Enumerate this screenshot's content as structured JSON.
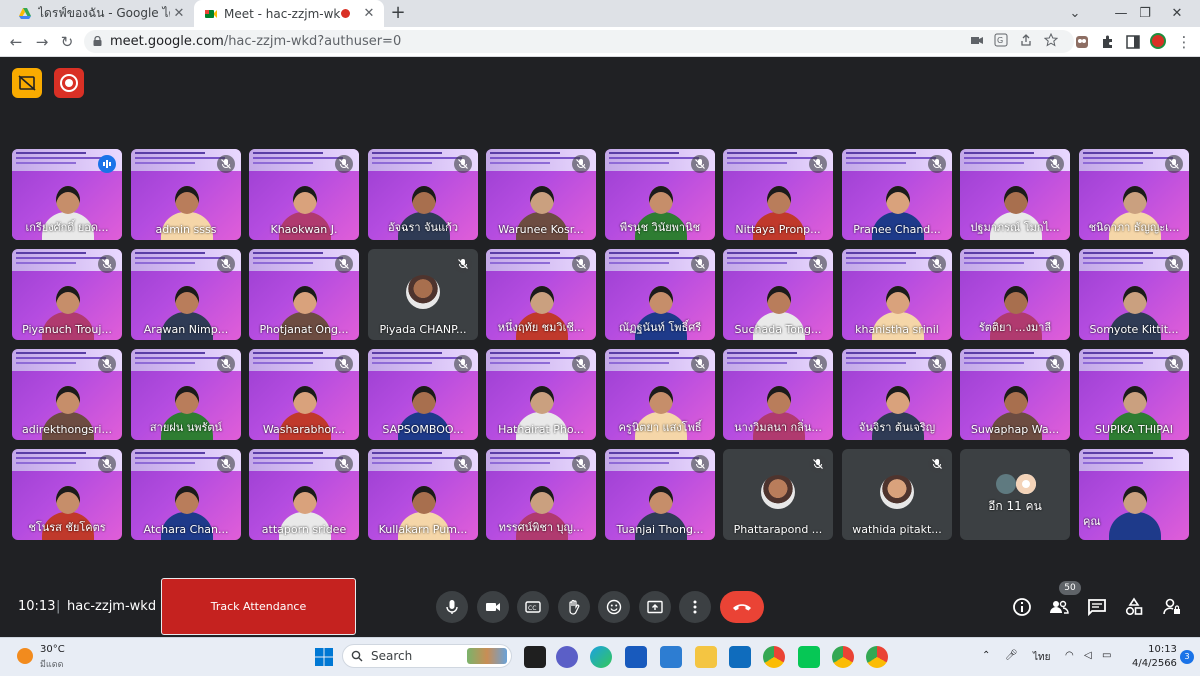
{
  "browser": {
    "tabs": [
      {
        "label": "ไดรฟ์ของฉัน - Google ไดรฟ์",
        "active": false
      },
      {
        "label": "Meet - hac-zzjm-wkd",
        "active": true
      }
    ],
    "url_host": "meet.google.com",
    "url_path": "/hac-zzjm-wkd?authuser=0"
  },
  "meet": {
    "time": "10:13",
    "separator": "|",
    "meeting_code": "hac-zzjm-wkd",
    "attendance_button": "Track Attendance",
    "participant_count": "50",
    "tiles": [
      {
        "name": "เกรียงศักดิ์ ยอด...",
        "type": "video",
        "speaking": true
      },
      {
        "name": "admin ssss",
        "type": "video"
      },
      {
        "name": "Khaokwan J.",
        "type": "video"
      },
      {
        "name": "อัจฉรา จันแก้ว",
        "type": "video"
      },
      {
        "name": "Warunee Kosr...",
        "type": "video"
      },
      {
        "name": "พีรนุช วินัยพานิช",
        "type": "video"
      },
      {
        "name": "Nittaya Pronp...",
        "type": "video"
      },
      {
        "name": "Pranee Chand...",
        "type": "video"
      },
      {
        "name": "ปฐมาภรณ์ โมกไ...",
        "type": "video"
      },
      {
        "name": "ชนิดาภา ธัญญะเ...",
        "type": "video"
      },
      {
        "name": "Piyanuch Trouj...",
        "type": "video"
      },
      {
        "name": "Arawan Nimp...",
        "type": "video"
      },
      {
        "name": "Photjanat Ong...",
        "type": "video"
      },
      {
        "name": "Piyada CHANP...",
        "type": "avatar"
      },
      {
        "name": "หนึ่งฤทัย ชมวิเชี...",
        "type": "video"
      },
      {
        "name": "ณัฏฐนันท์ โพธิ์ศรี",
        "type": "video"
      },
      {
        "name": "Suchada Tong...",
        "type": "video"
      },
      {
        "name": "khanistha srinil",
        "type": "video"
      },
      {
        "name": "รัตติยา ...งมาลี",
        "type": "video"
      },
      {
        "name": "Somyote Kittit...",
        "type": "video"
      },
      {
        "name": "adirekthongsri...",
        "type": "video"
      },
      {
        "name": "สายฝน นพรัตน์",
        "type": "video"
      },
      {
        "name": "Washarabhor...",
        "type": "video"
      },
      {
        "name": "SAPSOMBOO...",
        "type": "video"
      },
      {
        "name": "Hathairat Pho...",
        "type": "video"
      },
      {
        "name": "ครูนิตยา แสงโพธิ์",
        "type": "video"
      },
      {
        "name": "นางวิมลนา กลิ่น...",
        "type": "video"
      },
      {
        "name": "จันจิรา ต้นเจริญ",
        "type": "video"
      },
      {
        "name": "Suwaphap Wa...",
        "type": "video"
      },
      {
        "name": "SUPIKA THIPAI",
        "type": "video"
      },
      {
        "name": "ชโนรส ชัยโคตร",
        "type": "video"
      },
      {
        "name": "Atchara Chan...",
        "type": "video"
      },
      {
        "name": "attaporn sridee",
        "type": "video"
      },
      {
        "name": "Kullakarn Pum...",
        "type": "video"
      },
      {
        "name": "ทรรศน์พิชา บุญ...",
        "type": "video"
      },
      {
        "name": "Tuanjai Thong...",
        "type": "video"
      },
      {
        "name": "Phattarapond ...",
        "type": "avatar"
      },
      {
        "name": "wathida pitakt...",
        "type": "avatar"
      },
      {
        "name": "อีก 11 คน",
        "type": "more"
      },
      {
        "name": "คุณ",
        "type": "self"
      }
    ]
  },
  "taskbar": {
    "temperature": "30°C",
    "weather_desc": "มีแดด",
    "search_placeholder": "Search",
    "lang": "ไทย",
    "clock_time": "10:13",
    "clock_date": "4/4/2566",
    "notifications": "3"
  },
  "colors": {
    "meet_bg": "#202124",
    "end_call": "#ea4335",
    "attendance": "#c5221f",
    "slide_purple": "#b44ce0"
  }
}
